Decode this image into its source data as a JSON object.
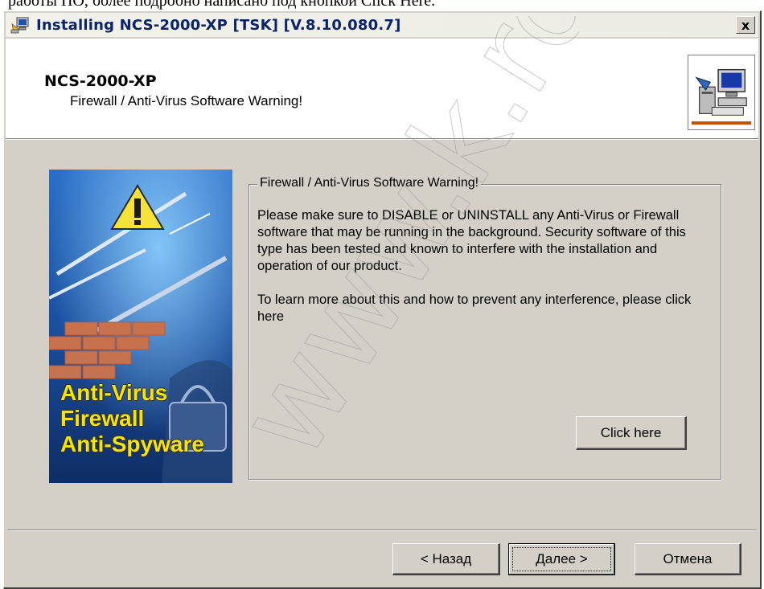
{
  "caption_text": "работы ПО, более подробно написано под кнопкой Click Here.",
  "window": {
    "title": "Installing NCS-2000-XP [TSK] [V.8.10.080.7]",
    "close_label": "x"
  },
  "header": {
    "product_name": "NCS-2000-XP",
    "subtitle": "Firewall / Anti-Virus Software Warning!"
  },
  "side_panel": {
    "lines": [
      "Anti-Virus",
      "Firewall",
      "Anti-Spyware"
    ]
  },
  "group": {
    "legend": "Firewall / Anti-Virus Software Warning!",
    "paragraph1": "Please make sure to DISABLE or UNINSTALL any Anti-Virus or Firewall software that may be running in the background. Security software of this type has been tested and known to interfere with the installation and operation of our product.",
    "paragraph2": "To learn more about this and how to prevent any interference, please click here",
    "click_here_label": "Click here"
  },
  "footer": {
    "back_label": "< Назад",
    "next_label": "Далее >",
    "cancel_label": "Отмена"
  },
  "watermark_text": "www.k.ro",
  "colors": {
    "dialog_bg": "#d4d0c8",
    "title_text": "#0a246a",
    "side_text": "#f0e414"
  }
}
